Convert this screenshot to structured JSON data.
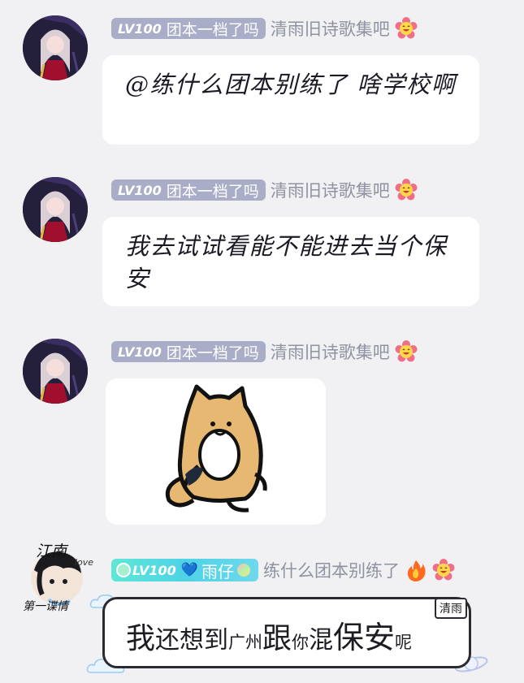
{
  "messages": [
    {
      "level": "LV100",
      "group_title": "团本一档了吗",
      "sender": "清雨旧诗歌集吧",
      "text": "@练什么团本别练了 啥学校啊"
    },
    {
      "level": "LV100",
      "group_title": "团本一档了吗",
      "sender": "清雨旧诗歌集吧",
      "text": "我去试试看能不能进去当个保安"
    },
    {
      "level": "LV100",
      "group_title": "团本一档了吗",
      "sender": "清雨旧诗歌集吧",
      "sticker": "cat-sticker"
    }
  ],
  "last_message": {
    "level": "LV100",
    "badge_heart": "💙",
    "group_title": "雨仔",
    "sender": "练什么团本别练了",
    "avatar_text_top": "江南",
    "avatar_text_side": "love",
    "avatar_text_bottom": "第一谍情",
    "corner_label": "清雨",
    "text_parts": [
      "我",
      "还想到",
      "广州",
      "跟",
      "你",
      "混",
      "保安",
      "呢"
    ]
  },
  "icons": {
    "flower": "smiley-flower-icon",
    "fire": "fire-icon"
  },
  "colors": {
    "background": "#f1f1f3",
    "tag_gray": "#a9adc8",
    "tag_cyan": "#4ed3e6",
    "sender_gray": "#8f93a1"
  }
}
